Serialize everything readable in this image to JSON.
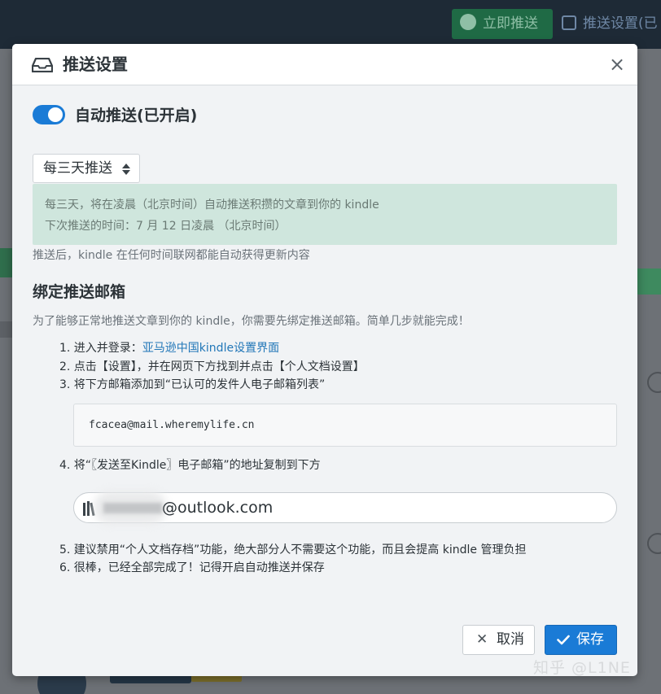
{
  "background": {
    "push_now_label": "立即推送",
    "push_settings_label": "推送设置(已"
  },
  "modal": {
    "title": "推送设置",
    "close_symbol": "×",
    "auto_push": {
      "label": "自动推送(已开启)",
      "enabled": true
    },
    "frequency_select": {
      "selected": "每三天推送"
    },
    "info_box": {
      "line1": "每三天，将在凌晨（北京时间）自动推送积攒的文章到你的 kindle",
      "line2": "下次推送的时间：7 月 12 日凌晨 （北京时间）"
    },
    "after_push_note": "推送后，kindle 在任何时间联网都能自动获得更新内容",
    "bind_section": {
      "title": "绑定推送邮箱",
      "description": "为了能够正常地推送文章到你的 kindle，你需要先绑定推送邮箱。简单几步就能完成！",
      "step1_prefix": "1. 进入并登录：",
      "step1_link": "亚马逊中国kindle设置界面",
      "step2": "2. 点击【设置】，并在网页下方找到并点击【个人文档设置】",
      "step3": "3. 将下方邮箱添加到“已认可的发件人电子邮箱列表”",
      "sender_email": "fcacea@mail.wheremylife.cn",
      "step4": "4. 将“〖发送至Kindle〗电子邮箱”的地址复制到下方",
      "kindle_email_suffix": "@outlook.com",
      "step5": "5. 建议禁用“个人文档存档”功能，绝大部分人不需要这个功能，而且会提高 kindle 管理负担",
      "step6": "6. 很棒，已经全部完成了！记得开启自动推送并保存"
    },
    "cancel_label": "取消",
    "save_label": "保存"
  },
  "watermark": "知乎 @L1NE",
  "colors": {
    "primary": "#1a7bd6",
    "info_bg": "#cfe6dd",
    "link": "#2277b8"
  }
}
